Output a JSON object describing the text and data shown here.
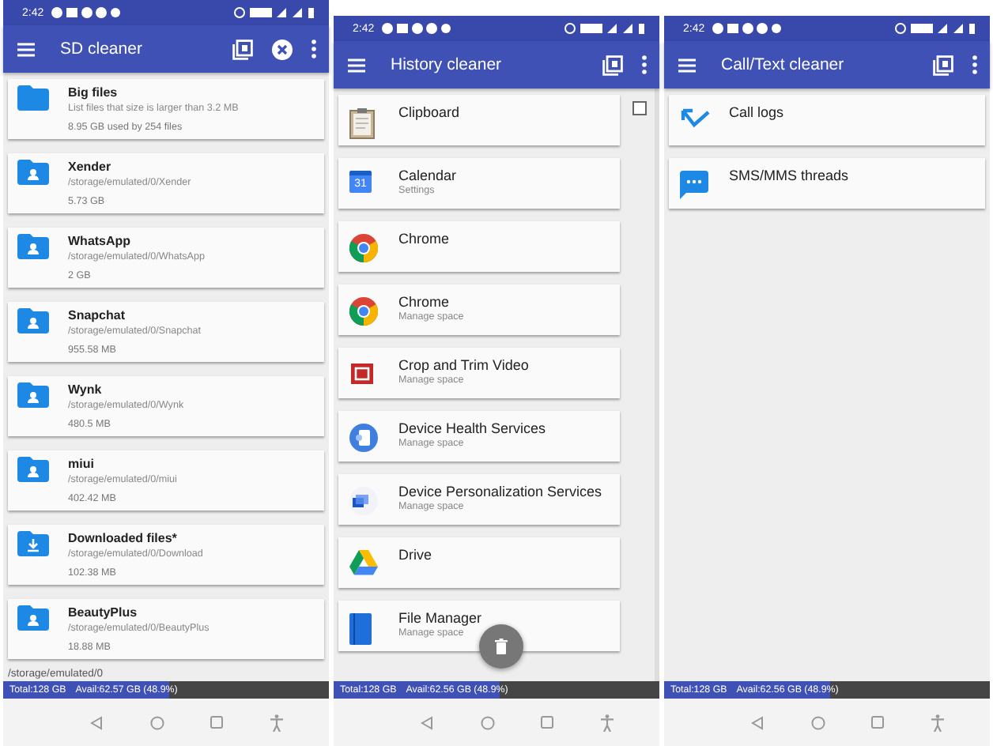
{
  "screens": [
    {
      "status_time": "2:42",
      "title": "SD cleaner",
      "actions": [
        {
          "kind": "storage"
        },
        {
          "kind": "close"
        },
        {
          "kind": "more"
        }
      ],
      "items": [
        {
          "kind": "folder",
          "title": "Big files",
          "subtitle": "List files that size is larger than 3.2 MB",
          "size": "8.95 GB used by 254 files"
        },
        {
          "kind": "person-folder",
          "title": "Xender",
          "subtitle": "/storage/emulated/0/Xender",
          "size": "5.73 GB"
        },
        {
          "kind": "person-folder",
          "title": "WhatsApp",
          "subtitle": "/storage/emulated/0/WhatsApp",
          "size": "2 GB"
        },
        {
          "kind": "person-folder",
          "title": "Snapchat",
          "subtitle": "/storage/emulated/0/Snapchat",
          "size": "955.58 MB"
        },
        {
          "kind": "person-folder",
          "title": "Wynk",
          "subtitle": "/storage/emulated/0/Wynk",
          "size": "480.5 MB"
        },
        {
          "kind": "person-folder",
          "title": "miui",
          "subtitle": "/storage/emulated/0/miui",
          "size": "402.42 MB"
        },
        {
          "kind": "download-folder",
          "title": "Downloaded files*",
          "subtitle": "/storage/emulated/0/Download",
          "size": "102.38 MB"
        },
        {
          "kind": "person-folder",
          "title": "BeautyPlus",
          "subtitle": "/storage/emulated/0/BeautyPlus",
          "size": "18.88 MB"
        }
      ],
      "path": "/storage/emulated/0",
      "storage": {
        "total": "Total:128 GB",
        "avail": "Avail:62.57 GB (48.9%)",
        "level": 0.51
      }
    },
    {
      "status_time": "2:42",
      "title": "History cleaner",
      "actions": [
        {
          "kind": "storage"
        },
        {
          "kind": "more"
        }
      ],
      "select_all": {
        "checked": false
      },
      "items": [
        {
          "kind": "clipboard",
          "title": "Clipboard"
        },
        {
          "kind": "calendar",
          "title": "Calendar",
          "subtitle": "Settings",
          "icon_text": "31"
        },
        {
          "kind": "round-logo",
          "title": "Chrome"
        },
        {
          "kind": "round-logo",
          "title": "Chrome",
          "subtitle": "Manage space"
        },
        {
          "kind": "crop",
          "title": "Crop and Trim Video",
          "subtitle": "Manage space"
        },
        {
          "kind": "health",
          "title": "Device Health Services",
          "subtitle": "Manage space"
        },
        {
          "kind": "layers",
          "title": "Device Personalization Services",
          "subtitle": "Manage space"
        },
        {
          "kind": "triangle-logo",
          "title": "Drive"
        },
        {
          "kind": "notebook",
          "title": "File Manager",
          "subtitle": "Manage space"
        }
      ],
      "fab": {
        "kind": "delete"
      },
      "storage": {
        "total": "Total:128 GB",
        "avail": "Avail:62.56 GB (48.9%)",
        "level": 0.51
      }
    },
    {
      "status_time": "2:42",
      "title": "Call/Text cleaner",
      "actions": [
        {
          "kind": "storage"
        },
        {
          "kind": "more"
        }
      ],
      "items": [
        {
          "kind": "arrow",
          "title": "Call logs"
        },
        {
          "kind": "chat",
          "title": "SMS/MMS threads"
        }
      ],
      "storage": {
        "total": "Total:128 GB",
        "avail": "Avail:62.56 GB (48.9%)",
        "level": 0.51
      }
    }
  ]
}
